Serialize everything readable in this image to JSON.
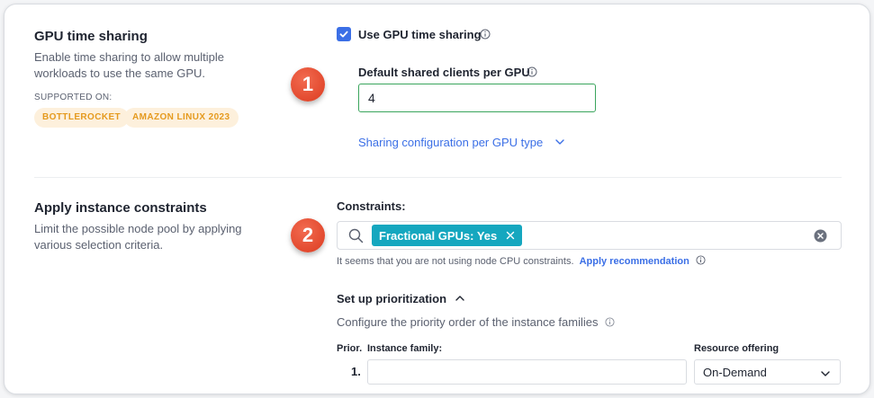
{
  "gpu_section": {
    "title": "GPU time sharing",
    "description_line1": "Enable time sharing to allow multiple",
    "description_line2": "workloads to use the same GPU.",
    "supported_on_label": "SUPPORTED ON:",
    "tags": [
      "BOTTLEROCKET",
      "AMAZON LINUX 2023"
    ],
    "checkbox_label": "Use GPU time sharing",
    "checkbox_checked": true,
    "clients_label": "Default shared clients per GPU",
    "clients_value": "4",
    "sharing_config_link": "Sharing configuration per GPU type"
  },
  "constraints_section": {
    "title": "Apply instance constraints",
    "description_line1": "Limit the possible node pool by applying",
    "description_line2": "various selection criteria.",
    "constraints_label": "Constraints:",
    "chip_label": "Fractional GPUs: Yes",
    "hint_text": "It seems that you are not using node CPU constraints.",
    "hint_link": "Apply recommendation",
    "prioritization_title": "Set up prioritization",
    "prioritization_desc": "Configure the priority order of the instance families",
    "columns": {
      "prior": "Prior.",
      "instance_family": "Instance family:",
      "resource_offering": "Resource offering"
    },
    "rows": [
      {
        "index": "1.",
        "instance_family": "",
        "resource_offering": "On-Demand"
      }
    ]
  },
  "markers": [
    "1",
    "2"
  ],
  "colors": {
    "accent": "#3b6fe6",
    "chip": "#15a7bf",
    "tag_bg": "#fdf0dc",
    "tag_text": "#e59a1e",
    "marker": "#e4472b",
    "input_border_active": "#3aa55d"
  }
}
